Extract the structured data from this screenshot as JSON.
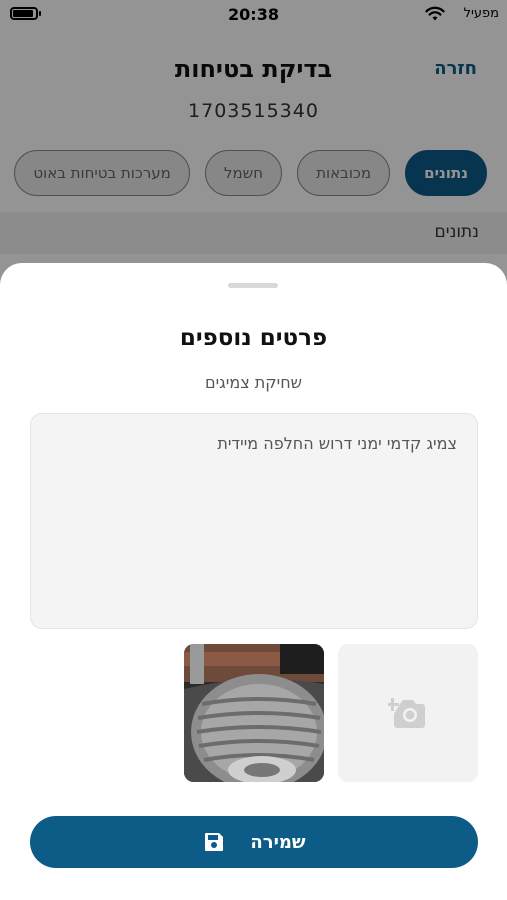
{
  "status_bar": {
    "time": "20:38",
    "carrier": "מפעיל",
    "icons": [
      "wifi-icon",
      "battery-icon"
    ]
  },
  "header": {
    "title": "בדיקת בטיחות",
    "back_label": "חזרה",
    "subtitle": "1703515340"
  },
  "tabs": [
    {
      "label": "נתונים",
      "active": true
    },
    {
      "label": "מכובאות",
      "active": false
    },
    {
      "label": "חשמל",
      "active": false
    },
    {
      "label": "מערכות בטיחות באוט",
      "active": false
    }
  ],
  "section": {
    "label": "נתונים"
  },
  "sheet": {
    "title": "פרטים נוספים",
    "subtitle": "שחיקת צמיגים",
    "notes_value": "צמיג קדמי ימני דרוש החלפה מיידית",
    "add_photo_icon": "camera-add-icon",
    "save_label": "שמירה",
    "save_icon": "floppy-disk-icon"
  },
  "colors": {
    "primary": "#0d5c88",
    "overlay": "rgba(0,0,0,0.42)"
  }
}
